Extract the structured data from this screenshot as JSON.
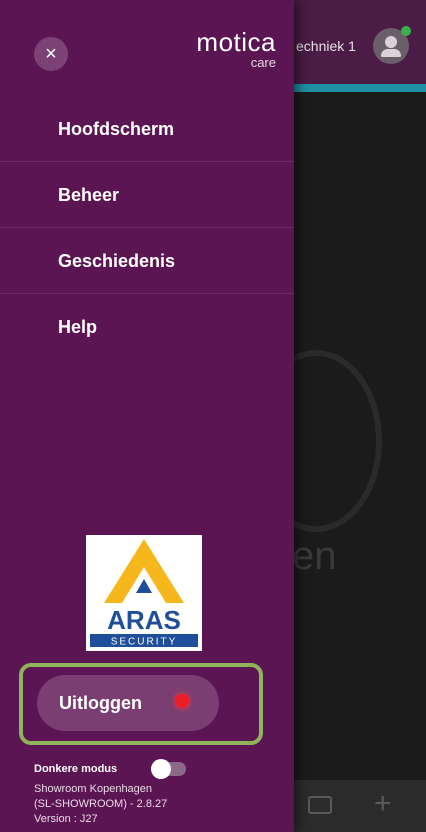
{
  "background": {
    "user_label": "echniek 1"
  },
  "drawer": {
    "close_symbol": "×",
    "brand": {
      "name": "motica",
      "sub": "care"
    },
    "nav_items": [
      {
        "label": "Hoofdscherm"
      },
      {
        "label": "Beheer"
      },
      {
        "label": "Geschiedenis"
      },
      {
        "label": "Help"
      }
    ],
    "logo": {
      "brand_text": "ARAS",
      "sub_text": "SECURITY",
      "colors": {
        "yellow": "#f5b71b",
        "blue": "#1f4e9a"
      }
    },
    "logout": {
      "label": "Uitloggen",
      "status_color": "#ee1c25"
    },
    "dark_mode": {
      "label": "Donkere modus",
      "enabled": false
    },
    "info": {
      "line1": "Showroom Kopenhagen",
      "line2": "(SL-SHOWROOM) - 2.8.27",
      "line3": "Version : J27"
    }
  },
  "colors": {
    "drawer_bg": "#5b1552",
    "header_bg": "#4a1c46",
    "accent": "#1f8fa3",
    "highlight_frame": "#8fb25a"
  }
}
